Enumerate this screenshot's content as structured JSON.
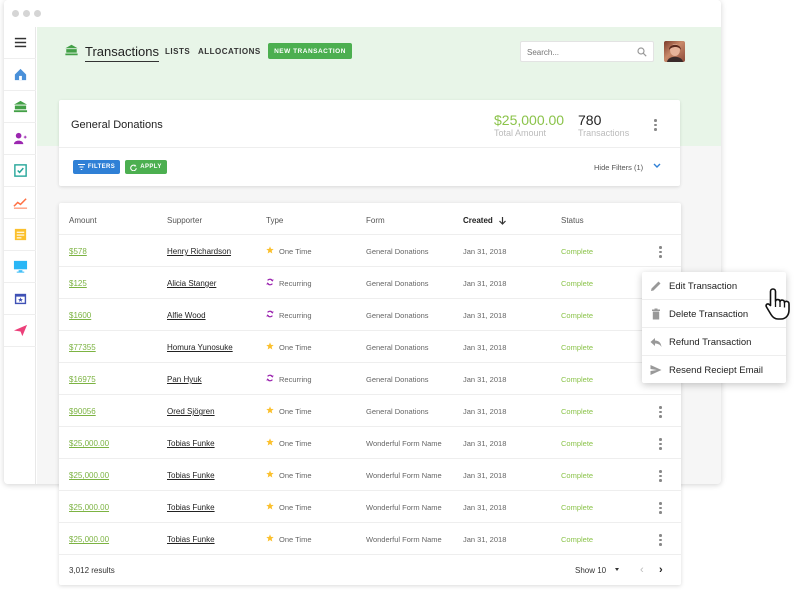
{
  "header": {
    "title": "Transactions",
    "nav": [
      "LISTS",
      "ALLOCATIONS"
    ],
    "new_button": "NEW TRANSACTION",
    "search_placeholder": "Search..."
  },
  "sidebar": {
    "items": [
      "menu-icon",
      "home-icon",
      "bank-icon",
      "users-icon",
      "tasks-icon",
      "reports-icon",
      "notes-icon",
      "monitor-icon",
      "calendar-icon",
      "send-icon"
    ]
  },
  "summary": {
    "title": "General Donations",
    "amount": "$25,000.00",
    "amount_label": "Total Amount",
    "count": "780",
    "count_label": "Transactions",
    "filters_label": "FILTERS",
    "apply_label": "APPLY",
    "hide_filters": "Hide Filters (1)"
  },
  "table": {
    "headers": [
      "Amount",
      "Supporter",
      "Type",
      "Form",
      "Created",
      "Status"
    ],
    "rows": [
      {
        "amount": "$578",
        "supporter": "Henry Richardson",
        "type": "One Time",
        "form": "General Donations",
        "created": "Jan 31, 2018",
        "status": "Complete"
      },
      {
        "amount": "$125",
        "supporter": "Alicia Stanger",
        "type": "Recurring",
        "form": "General Donations",
        "created": "Jan 31, 2018",
        "status": "Complete"
      },
      {
        "amount": "$1600",
        "supporter": "Alfie Wood",
        "type": "Recurring",
        "form": "General Donations",
        "created": "Jan 31, 2018",
        "status": "Complete"
      },
      {
        "amount": "$77355",
        "supporter": "Homura Yunosuke",
        "type": "One Time",
        "form": "General Donations",
        "created": "Jan 31, 2018",
        "status": "Complete"
      },
      {
        "amount": "$16975",
        "supporter": "Pan Hyuk",
        "type": "Recurring",
        "form": "General Donations",
        "created": "Jan 31, 2018",
        "status": "Complete"
      },
      {
        "amount": "$90056",
        "supporter": "Ored Sjögren",
        "type": "One Time",
        "form": "General Donations",
        "created": "Jan 31, 2018",
        "status": "Complete"
      },
      {
        "amount": "$25,000.00",
        "supporter": "Tobias Funke",
        "type": "One Time",
        "form": "Wonderful Form Name",
        "created": "Jan 31, 2018",
        "status": "Complete"
      },
      {
        "amount": "$25,000.00",
        "supporter": "Tobias Funke",
        "type": "One Time",
        "form": "Wonderful Form Name",
        "created": "Jan 31, 2018",
        "status": "Complete"
      },
      {
        "amount": "$25,000.00",
        "supporter": "Tobias Funke",
        "type": "One Time",
        "form": "Wonderful Form Name",
        "created": "Jan 31, 2018",
        "status": "Complete"
      },
      {
        "amount": "$25,000.00",
        "supporter": "Tobias Funke",
        "type": "One Time",
        "form": "Wonderful Form Name",
        "created": "Jan 31, 2018",
        "status": "Complete"
      }
    ],
    "results": "3,012 results",
    "show": "Show 10"
  },
  "context_menu": {
    "items": [
      "Edit Transaction",
      "Delete Transaction",
      "Refund Transaction",
      "Resend Reciept Email"
    ]
  },
  "colors": {
    "accent_green": "#4caf50",
    "amount_green": "#7cb342",
    "filters_blue": "#2f80d6",
    "header_band": "#e8f5e8"
  }
}
